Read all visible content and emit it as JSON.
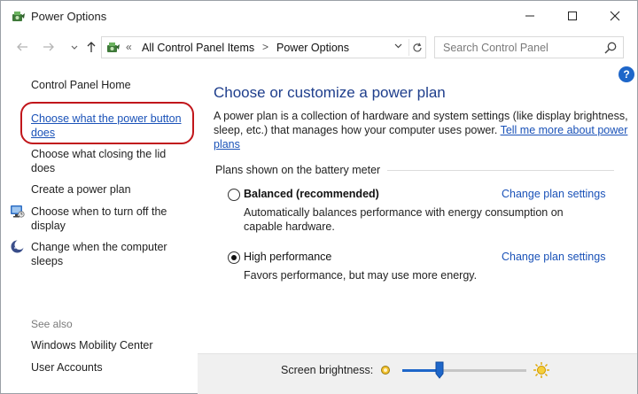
{
  "window": {
    "title": "Power Options",
    "controls": [
      "minimize",
      "maximize",
      "close"
    ]
  },
  "navigation": {
    "back_icon": "left-arrow-icon",
    "forward_icon": "right-arrow-icon",
    "up_icon": "up-arrow-icon",
    "address": {
      "chevron": "«",
      "crumbs": [
        "All Control Panel Items",
        "Power Options"
      ],
      "separator": ">"
    },
    "search": {
      "placeholder": "Search Control Panel",
      "value": ""
    }
  },
  "sidebar": {
    "home": "Control Panel Home",
    "links": [
      {
        "label": "Choose what the power button does",
        "active": true,
        "highlighted": true
      },
      {
        "label": "Choose what closing the lid does",
        "active": false
      },
      {
        "label": "Create a power plan",
        "active": false
      },
      {
        "label": "Choose when to turn off the display",
        "active": false,
        "icon": "display-power-icon"
      },
      {
        "label": "Change when the computer sleeps",
        "active": false,
        "icon": "moon-sleep-icon"
      }
    ],
    "see_also": {
      "heading": "See also",
      "items": [
        "Windows Mobility Center",
        "User Accounts"
      ]
    }
  },
  "main": {
    "title": "Choose or customize a power plan",
    "description": "A power plan is a collection of hardware and system settings (like display brightness, sleep, etc.) that manages how your computer uses power.",
    "learn_more": "Tell me more about power plans",
    "plans_label": "Plans shown on the battery meter",
    "plans": [
      {
        "name": "Balanced (recommended)",
        "selected": false,
        "change_link": "Change plan settings",
        "description": "Automatically balances performance with energy consumption on capable hardware."
      },
      {
        "name": "High performance",
        "selected": true,
        "change_link": "Change plan settings",
        "description": "Favors performance, but may use more energy."
      }
    ]
  },
  "brightness": {
    "label": "Screen brightness:",
    "level_percent": 30
  },
  "colors": {
    "accent": "#1e66c9",
    "link": "#1a52b8",
    "title": "#1e3e8c",
    "highlight_ring": "#c1161b"
  }
}
